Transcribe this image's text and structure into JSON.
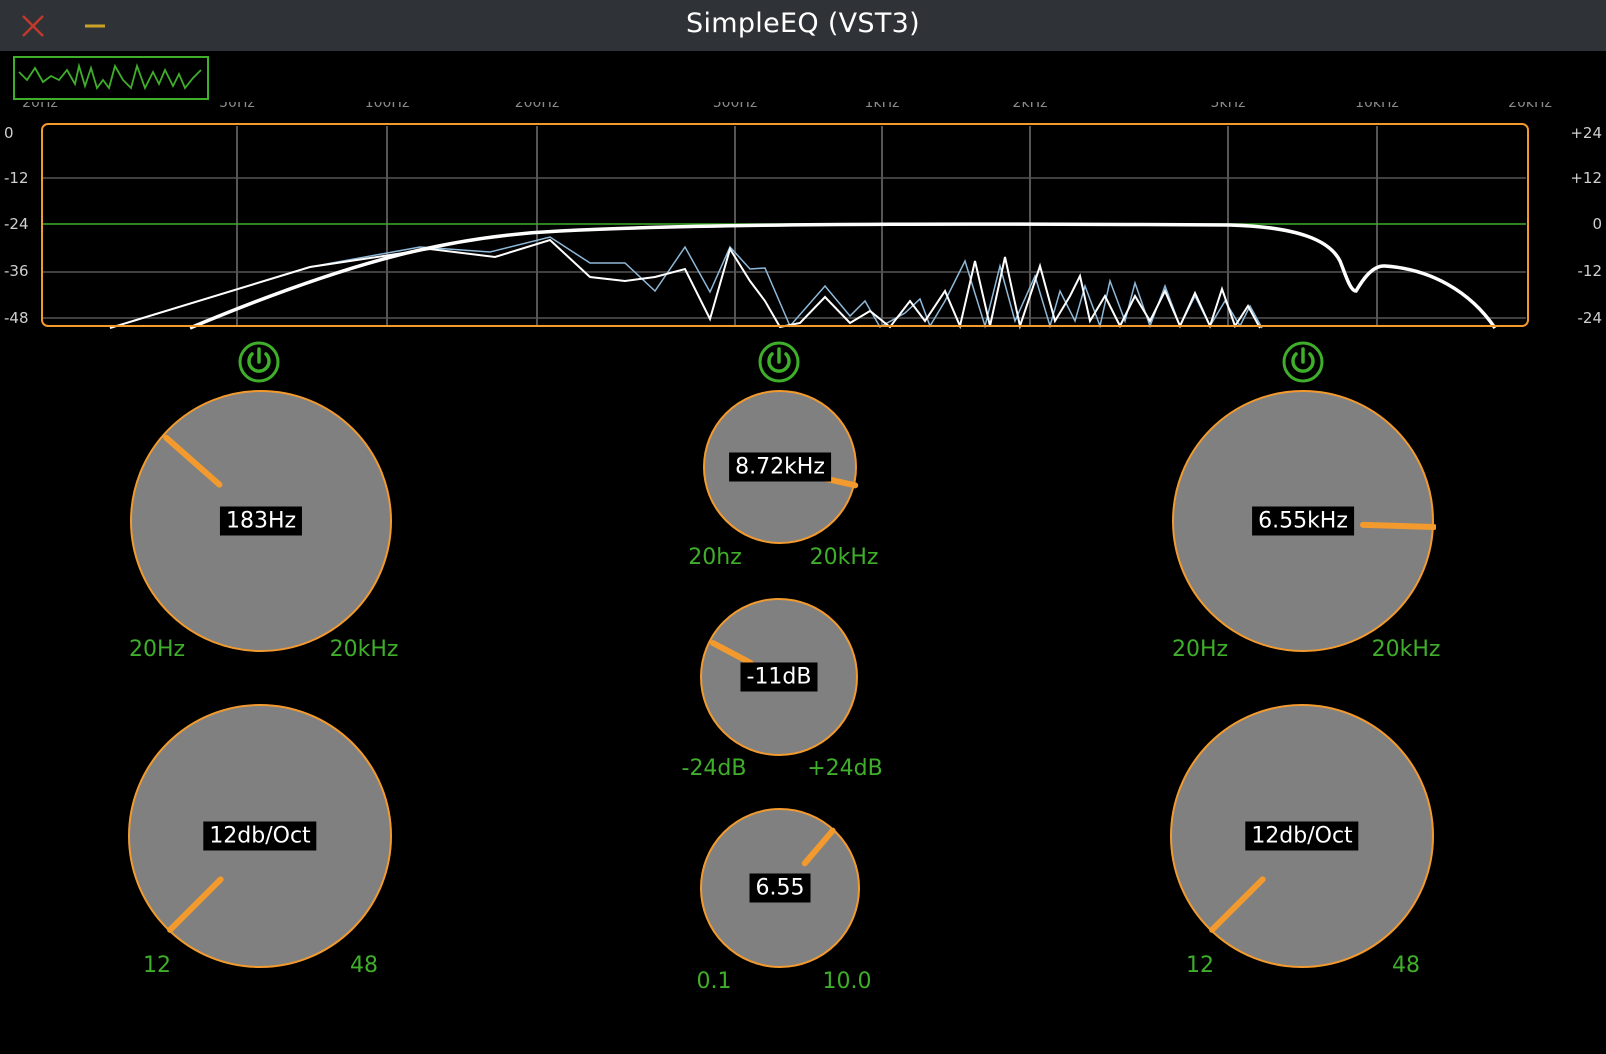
{
  "window": {
    "title": "SimpleEQ (VST3)",
    "close_icon": "close-icon",
    "minimize_icon": "minimize-icon"
  },
  "analyzer": {
    "toggle_icon": "waveform-icon",
    "freq_labels": [
      "20Hz",
      "50Hz",
      "100Hz",
      "200Hz",
      "500Hz",
      "1kHz",
      "2kHz",
      "5kHz",
      "10kHz",
      "20kHz"
    ],
    "left_db": [
      "0",
      "-12",
      "-24",
      "-36",
      "-48"
    ],
    "right_db": [
      "+24",
      "+12",
      "0",
      "-12",
      "-24"
    ]
  },
  "low_cut": {
    "bypass_icon": "power-icon",
    "freq": {
      "value": "183Hz",
      "min": "20Hz",
      "max": "20kHz",
      "position": 0.32
    },
    "slope": {
      "value": "12db/Oct",
      "min": "12",
      "max": "48",
      "position": 0.0
    }
  },
  "peak": {
    "bypass_icon": "power-icon",
    "freq": {
      "value": "8.72kHz",
      "min": "20hz",
      "max": "20kHz",
      "position": 0.88
    },
    "gain": {
      "value": "-11dB",
      "min": "-24dB",
      "max": "+24dB",
      "position": 0.27
    },
    "quality": {
      "value": "6.55",
      "min": "0.1",
      "max": "10.0",
      "position": 0.65
    }
  },
  "high_cut": {
    "bypass_icon": "power-icon",
    "freq": {
      "value": "6.55kHz",
      "min": "20Hz",
      "max": "20kHz",
      "position": 0.84
    },
    "slope": {
      "value": "12db/Oct",
      "min": "12",
      "max": "48",
      "position": 0.0
    }
  },
  "colors": {
    "accent_orange": "#f29a2e",
    "green": "#3fae2a",
    "knob_fill": "#808080",
    "title_bar": "#2f3237"
  }
}
